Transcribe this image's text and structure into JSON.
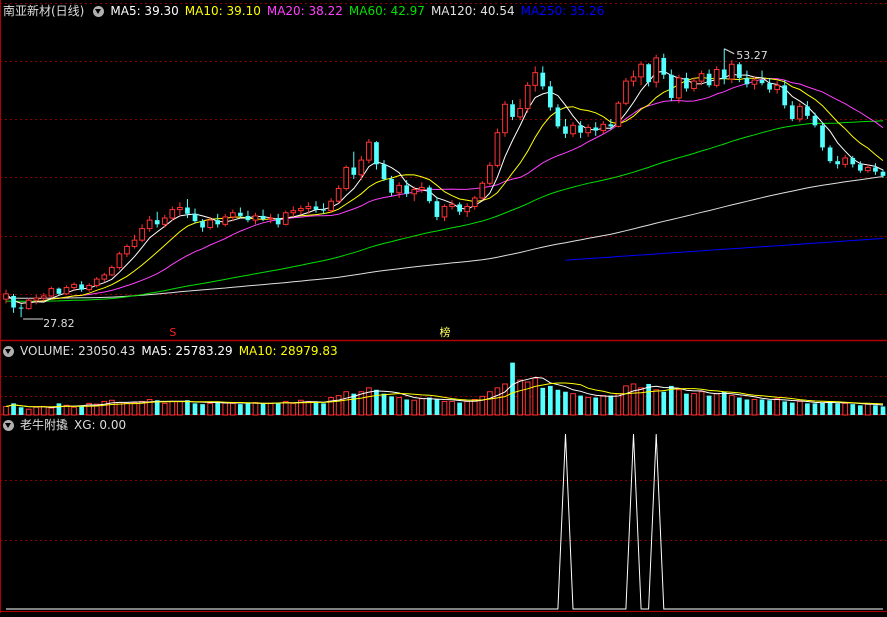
{
  "main": {
    "stock_name": "南亚新材(日线)",
    "ma": [
      {
        "label": "MA5: 39.30",
        "color": "#ffffff"
      },
      {
        "label": "MA10: 39.10",
        "color": "#ffff00"
      },
      {
        "label": "MA20: 38.22",
        "color": "#ff40ff"
      },
      {
        "label": "MA60: 42.97",
        "color": "#00e000"
      },
      {
        "label": "MA120: 40.54",
        "color": "#e0e0e0"
      },
      {
        "label": "MA250: 35.26",
        "color": "#0000ff"
      }
    ],
    "high_label": "53.27",
    "low_label": "27.82",
    "signal_s": "S",
    "signal_bang": "榜"
  },
  "volume": {
    "title": "VOLUME: 23050.43",
    "ma5": "MA5: 25783.29",
    "ma10": "MA10: 28979.83"
  },
  "indicator": {
    "title": "老牛附撬",
    "xg": "XG: 0.00"
  },
  "colors": {
    "up": "#ff3232",
    "down": "#54ffff",
    "grid": "#8b0000",
    "divider": "#b00000",
    "ma5": "#ffffff",
    "ma10": "#ffff00",
    "ma20": "#ff40ff",
    "ma60": "#00e000",
    "ma120": "#e0e0e0",
    "ma250": "#0000ff"
  },
  "chart_data": {
    "type": "candlestick",
    "price_range": [
      26,
      56
    ],
    "candles_ohlc": [
      [
        29.5,
        30.4,
        29.1,
        30.0
      ],
      [
        29.8,
        30.0,
        28.2,
        28.7
      ],
      [
        28.7,
        29.0,
        27.8,
        28.6
      ],
      [
        28.6,
        29.6,
        28.5,
        29.4
      ],
      [
        29.4,
        29.9,
        29.0,
        29.6
      ],
      [
        29.6,
        30.1,
        29.3,
        29.8
      ],
      [
        29.8,
        30.7,
        29.6,
        30.5
      ],
      [
        30.5,
        30.6,
        29.8,
        30.0
      ],
      [
        30.0,
        30.8,
        29.9,
        30.6
      ],
      [
        30.6,
        31.1,
        30.3,
        30.9
      ],
      [
        30.9,
        31.2,
        30.2,
        30.4
      ],
      [
        30.4,
        31.0,
        30.2,
        30.8
      ],
      [
        30.8,
        31.6,
        30.6,
        31.4
      ],
      [
        31.4,
        32.0,
        31.1,
        31.8
      ],
      [
        31.8,
        32.7,
        31.7,
        32.5
      ],
      [
        32.5,
        34.0,
        32.3,
        33.8
      ],
      [
        33.8,
        34.7,
        33.5,
        34.5
      ],
      [
        34.5,
        35.6,
        34.3,
        35.1
      ],
      [
        35.1,
        36.6,
        34.9,
        36.2
      ],
      [
        36.2,
        37.4,
        35.9,
        37.0
      ],
      [
        37.0,
        37.8,
        36.3,
        36.6
      ],
      [
        36.6,
        37.5,
        36.3,
        37.2
      ],
      [
        37.2,
        38.3,
        36.9,
        38.0
      ],
      [
        38.0,
        38.7,
        37.4,
        38.2
      ],
      [
        38.2,
        39.0,
        37.2,
        37.6
      ],
      [
        37.6,
        38.1,
        36.7,
        36.9
      ],
      [
        36.9,
        37.1,
        35.9,
        36.3
      ],
      [
        36.3,
        37.3,
        36.1,
        37.0
      ],
      [
        37.0,
        37.6,
        36.3,
        36.6
      ],
      [
        36.6,
        37.6,
        36.4,
        37.3
      ],
      [
        37.3,
        38.0,
        36.9,
        37.7
      ],
      [
        37.7,
        38.2,
        37.2,
        37.4
      ],
      [
        37.4,
        37.9,
        36.8,
        37.0
      ],
      [
        37.0,
        37.7,
        36.6,
        37.4
      ],
      [
        37.4,
        38.0,
        36.9,
        37.1
      ],
      [
        37.1,
        37.6,
        36.7,
        37.2
      ],
      [
        37.2,
        37.6,
        36.3,
        36.6
      ],
      [
        36.6,
        37.9,
        36.5,
        37.7
      ],
      [
        37.7,
        38.3,
        37.3,
        37.9
      ],
      [
        37.9,
        38.4,
        37.5,
        38.1
      ],
      [
        38.1,
        38.7,
        37.6,
        38.3
      ],
      [
        38.3,
        38.8,
        37.7,
        38.0
      ],
      [
        38.0,
        38.6,
        37.6,
        37.9
      ],
      [
        37.9,
        39.1,
        37.7,
        38.8
      ],
      [
        38.8,
        40.3,
        38.6,
        40.0
      ],
      [
        40.0,
        42.2,
        39.8,
        42.0
      ],
      [
        42.0,
        43.5,
        40.9,
        41.3
      ],
      [
        41.3,
        43.1,
        40.8,
        42.7
      ],
      [
        42.7,
        44.7,
        42.4,
        44.4
      ],
      [
        44.4,
        44.5,
        41.8,
        42.3
      ],
      [
        42.3,
        42.7,
        40.7,
        40.9
      ],
      [
        40.9,
        41.2,
        39.3,
        39.6
      ],
      [
        39.6,
        40.6,
        39.1,
        40.3
      ],
      [
        40.3,
        40.8,
        39.2,
        39.5
      ],
      [
        39.5,
        40.2,
        38.8,
        39.9
      ],
      [
        39.9,
        40.6,
        39.6,
        40.1
      ],
      [
        40.1,
        40.3,
        38.6,
        38.8
      ],
      [
        38.8,
        39.2,
        37.0,
        37.3
      ],
      [
        37.3,
        38.5,
        36.9,
        38.3
      ],
      [
        38.3,
        38.9,
        38.0,
        38.5
      ],
      [
        38.5,
        38.7,
        37.5,
        37.8
      ],
      [
        37.8,
        38.6,
        37.3,
        38.3
      ],
      [
        38.3,
        39.3,
        38.0,
        39.1
      ],
      [
        39.1,
        40.7,
        38.9,
        40.5
      ],
      [
        40.5,
        42.5,
        40.3,
        42.2
      ],
      [
        42.2,
        45.7,
        42.0,
        45.3
      ],
      [
        45.3,
        48.3,
        44.9,
        48.0
      ],
      [
        48.0,
        48.4,
        46.5,
        46.8
      ],
      [
        46.8,
        48.5,
        46.5,
        47.6
      ],
      [
        47.6,
        50.1,
        47.2,
        49.8
      ],
      [
        49.8,
        51.6,
        49.2,
        51.0
      ],
      [
        51.0,
        51.6,
        49.4,
        49.7
      ],
      [
        49.7,
        50.2,
        47.4,
        47.7
      ],
      [
        47.7,
        48.0,
        45.7,
        45.9
      ],
      [
        45.9,
        46.6,
        44.8,
        45.2
      ],
      [
        45.2,
        46.3,
        44.9,
        46.0
      ],
      [
        46.0,
        46.4,
        44.8,
        45.3
      ],
      [
        45.3,
        46.1,
        44.9,
        45.8
      ],
      [
        45.8,
        46.3,
        45.0,
        45.5
      ],
      [
        45.5,
        46.4,
        45.2,
        46.1
      ],
      [
        46.1,
        46.6,
        45.6,
        45.9
      ],
      [
        45.9,
        48.3,
        45.8,
        48.1
      ],
      [
        48.1,
        50.5,
        47.9,
        50.2
      ],
      [
        50.2,
        51.2,
        49.7,
        50.6
      ],
      [
        50.6,
        52.0,
        49.8,
        51.8
      ],
      [
        51.8,
        51.9,
        49.7,
        50.1
      ],
      [
        50.1,
        52.7,
        49.6,
        52.4
      ],
      [
        52.4,
        52.8,
        50.4,
        50.8
      ],
      [
        50.8,
        51.3,
        48.3,
        48.6
      ],
      [
        48.6,
        50.8,
        48.1,
        50.5
      ],
      [
        50.5,
        51.0,
        49.2,
        49.5
      ],
      [
        49.5,
        50.5,
        49.2,
        50.2
      ],
      [
        50.2,
        51.2,
        49.8,
        50.9
      ],
      [
        50.9,
        51.3,
        49.6,
        49.8
      ],
      [
        49.8,
        51.6,
        49.6,
        51.3
      ],
      [
        51.3,
        53.27,
        49.9,
        50.4
      ],
      [
        50.4,
        52.2,
        50.0,
        51.8
      ],
      [
        51.8,
        52.0,
        50.1,
        50.5
      ],
      [
        50.5,
        51.2,
        49.6,
        49.9
      ],
      [
        49.9,
        50.7,
        49.4,
        50.3
      ],
      [
        50.3,
        51.2,
        49.8,
        50.0
      ],
      [
        50.0,
        50.5,
        49.1,
        49.4
      ],
      [
        49.4,
        50.2,
        49.0,
        49.8
      ],
      [
        49.8,
        50.3,
        47.6,
        47.9
      ],
      [
        47.9,
        48.3,
        46.4,
        46.6
      ],
      [
        46.6,
        48.1,
        46.3,
        47.8
      ],
      [
        47.8,
        48.3,
        46.6,
        46.9
      ],
      [
        46.9,
        47.2,
        45.8,
        46.0
      ],
      [
        46.0,
        46.3,
        43.6,
        43.9
      ],
      [
        43.9,
        44.1,
        42.4,
        42.6
      ],
      [
        42.6,
        43.1,
        41.9,
        42.3
      ],
      [
        42.3,
        43.2,
        42.0,
        42.9
      ],
      [
        42.9,
        43.1,
        42.0,
        42.3
      ],
      [
        42.3,
        42.6,
        41.5,
        41.7
      ],
      [
        41.7,
        42.3,
        41.5,
        42.0
      ],
      [
        42.0,
        42.4,
        41.3,
        41.6
      ],
      [
        41.6,
        41.8,
        41.0,
        41.2
      ]
    ],
    "volumes": [
      2.2,
      3.0,
      2.0,
      1.5,
      2.0,
      2.2,
      1.8,
      3.0,
      2.5,
      2.0,
      2.5,
      3.0,
      2.8,
      3.5,
      3.8,
      3.2,
      3.0,
      3.2,
      3.5,
      4.0,
      3.8,
      3.0,
      3.5,
      3.5,
      3.8,
      3.0,
      2.8,
      3.0,
      3.5,
      3.2,
      3.0,
      2.8,
      3.0,
      3.2,
      3.0,
      3.0,
      3.2,
      3.5,
      3.0,
      3.8,
      3.5,
      3.2,
      3.0,
      4.5,
      5.0,
      6.0,
      5.5,
      6.0,
      7.0,
      6.5,
      5.5,
      4.8,
      4.5,
      4.0,
      3.8,
      4.2,
      4.5,
      4.0,
      3.5,
      3.5,
      3.2,
      3.5,
      4.0,
      4.8,
      6.0,
      7.0,
      8.0,
      13.5,
      9.0,
      8.5,
      9.5,
      7.0,
      7.5,
      6.5,
      6.0,
      5.5,
      5.0,
      4.5,
      4.5,
      5.0,
      5.0,
      5.5,
      7.5,
      8.0,
      7.0,
      8.0,
      6.5,
      6.0,
      7.5,
      6.5,
      5.5,
      5.5,
      6.0,
      5.0,
      5.5,
      6.0,
      5.0,
      4.5,
      4.0,
      4.0,
      4.0,
      3.8,
      4.2,
      3.5,
      3.2,
      3.5,
      3.0,
      3.0,
      3.2,
      3.5,
      3.0,
      3.0,
      2.8,
      2.5,
      2.8,
      2.5,
      2.2
    ],
    "ma250_segment": {
      "start_index": 74,
      "from": 33.2,
      "to": 35.26
    },
    "xg_peaks_index": [
      74,
      83,
      86
    ],
    "xg_values": [
      0,
      1
    ]
  }
}
